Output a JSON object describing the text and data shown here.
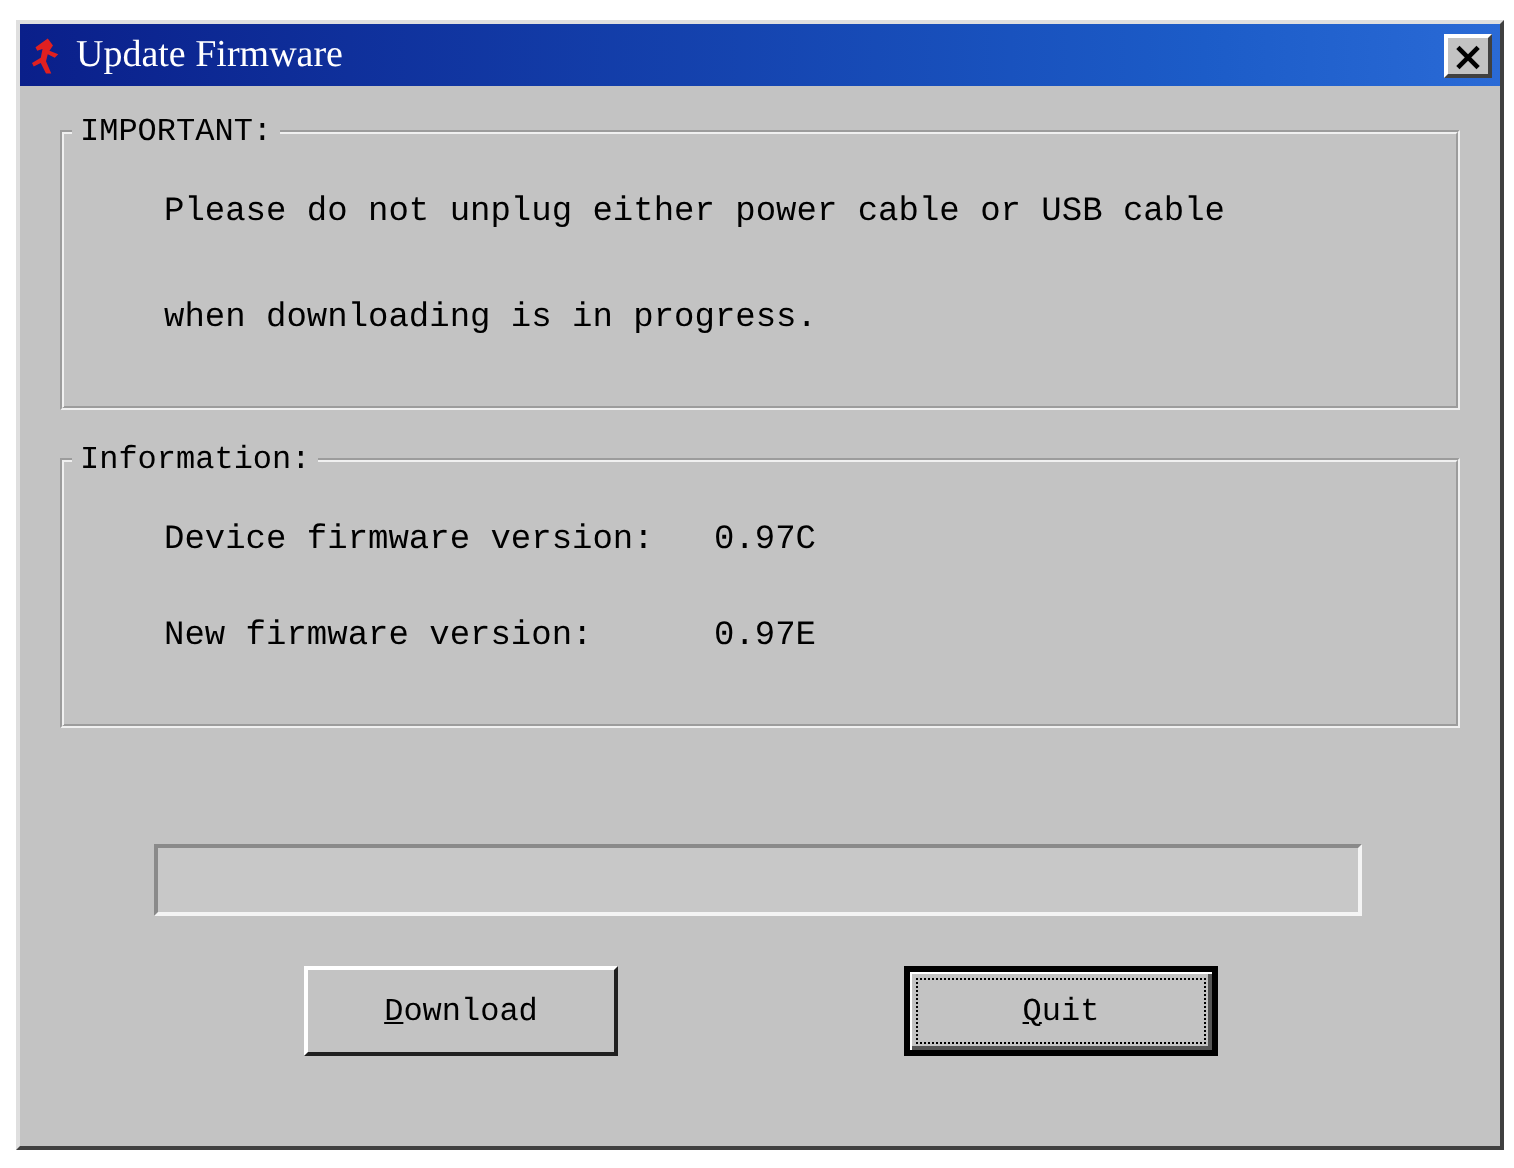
{
  "window": {
    "title": "Update Firmware",
    "close": "×"
  },
  "groups": [
    {
      "title": "IMPORTANT:",
      "kind": "message",
      "lines": [
        "Please do not unplug either power cable or USB cable",
        "when downloading is in progress."
      ]
    },
    {
      "title": "Information:",
      "kind": "fields",
      "rows": [
        {
          "label": "Device firmware version:",
          "value": "0.97C"
        },
        {
          "label": "New firmware version:",
          "value": "0.97E"
        }
      ]
    }
  ],
  "buttons": [
    {
      "label": "Download",
      "default": false
    },
    {
      "label": "Quit",
      "default": true
    }
  ]
}
